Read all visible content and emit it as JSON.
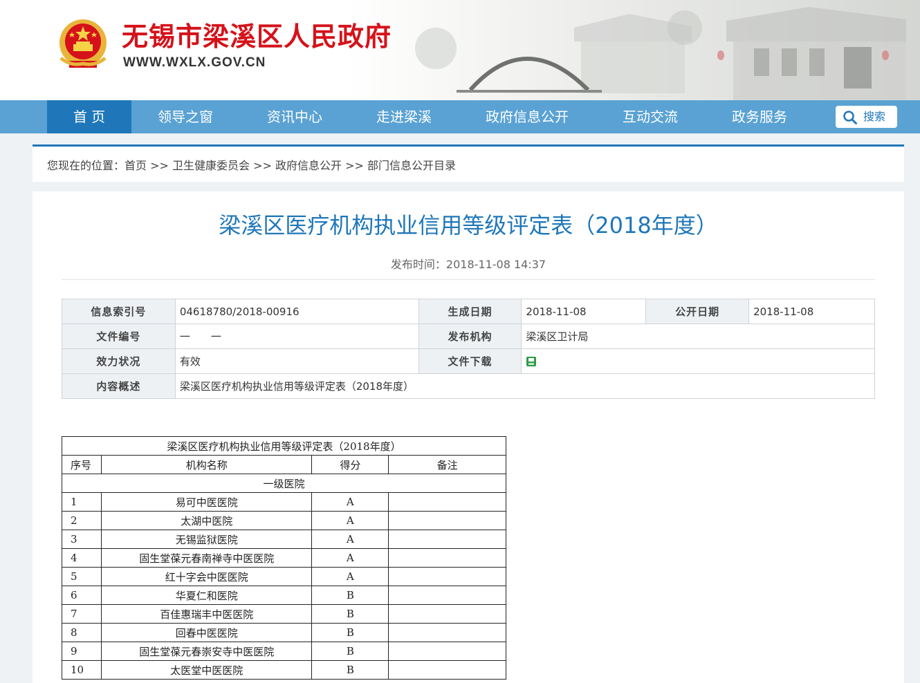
{
  "header": {
    "title": "无锡市梁溪区人民政府",
    "url": "WWW.WXLX.GOV.CN"
  },
  "nav": {
    "items": [
      "首 页",
      "领导之窗",
      "资讯中心",
      "走进梁溪",
      "政府信息公开",
      "互动交流",
      "政务服务"
    ],
    "active_index": 0,
    "search_label": "搜索"
  },
  "breadcrumb": {
    "prefix": "您现在的位置：",
    "items": [
      "首页",
      "卫生健康委员会",
      "政府信息公开",
      "部门信息公开目录"
    ],
    "separator": " >> "
  },
  "article": {
    "title": "梁溪区医疗机构执业信用等级评定表（2018年度）",
    "publish_label": "发布时间：",
    "publish_time": "2018-11-08 14:37"
  },
  "meta": {
    "index_label": "信息索引号",
    "index_value": "04618780/2018-00916",
    "created_label": "生成日期",
    "created_value": "2018-11-08",
    "public_label": "公开日期",
    "public_value": "2018-11-08",
    "doc_no_label": "文件编号",
    "doc_no_value": "一　　一",
    "issuer_label": "发布机构",
    "issuer_value": "梁溪区卫计局",
    "status_label": "效力状况",
    "status_value": "有效",
    "download_label": "文件下载",
    "download_icon": "excel-file-icon",
    "summary_label": "内容概述",
    "summary_value": "梁溪区医疗机构执业信用等级评定表（2018年度）"
  },
  "table": {
    "caption": "梁溪区医疗机构执业信用等级评定表（2018年度）",
    "headers": [
      "序号",
      "机构名称",
      "得分",
      "备注"
    ],
    "section": "一级医院",
    "rows": [
      {
        "no": "1",
        "name": "易可中医医院",
        "score": "A",
        "note": ""
      },
      {
        "no": "2",
        "name": "太湖中医院",
        "score": "A",
        "note": ""
      },
      {
        "no": "3",
        "name": "无锡监狱医院",
        "score": "A",
        "note": ""
      },
      {
        "no": "4",
        "name": "固生堂葆元春南禅寺中医医院",
        "score": "A",
        "note": ""
      },
      {
        "no": "5",
        "name": "红十字会中医医院",
        "score": "A",
        "note": ""
      },
      {
        "no": "6",
        "name": "华夏仁和医院",
        "score": "B",
        "note": ""
      },
      {
        "no": "7",
        "name": "百佳惠瑞丰中医医院",
        "score": "B",
        "note": ""
      },
      {
        "no": "8",
        "name": "回春中医医院",
        "score": "B",
        "note": ""
      },
      {
        "no": "9",
        "name": "固生堂葆元春崇安寺中医医院",
        "score": "B",
        "note": ""
      },
      {
        "no": "10",
        "name": "太医堂中医医院",
        "score": "B",
        "note": ""
      }
    ]
  },
  "colors": {
    "brand_red": "#d5121a",
    "nav_blue": "#5aa2d3",
    "nav_active": "#1f77b9",
    "title_blue": "#1f77b9"
  }
}
